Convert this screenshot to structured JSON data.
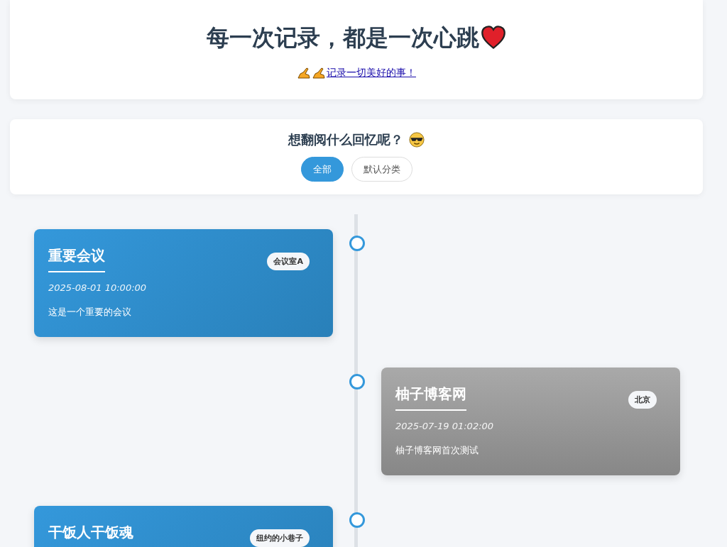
{
  "header": {
    "title": "每一次记录，都是一次心跳",
    "subtitle_link": "记录一切美好的事！"
  },
  "filter": {
    "title": "想翻阅什么回忆呢？",
    "categories": [
      {
        "label": "全部",
        "selected": true
      },
      {
        "label": "默认分类",
        "selected": false
      }
    ]
  },
  "timeline": [
    {
      "kind": "blue",
      "title": "重要会议",
      "location": "会议室A",
      "date": "2025-08-01 10:00:00",
      "description": "这是一个重要的会议"
    },
    {
      "kind": "grey",
      "title": "柚子博客网",
      "location": "北京",
      "date": "2025-07-19 01:02:00",
      "description": "柚子博客网首次测试"
    },
    {
      "kind": "blue",
      "title": "干饭人干饭魂",
      "location": "纽约的小巷子"
    }
  ]
}
